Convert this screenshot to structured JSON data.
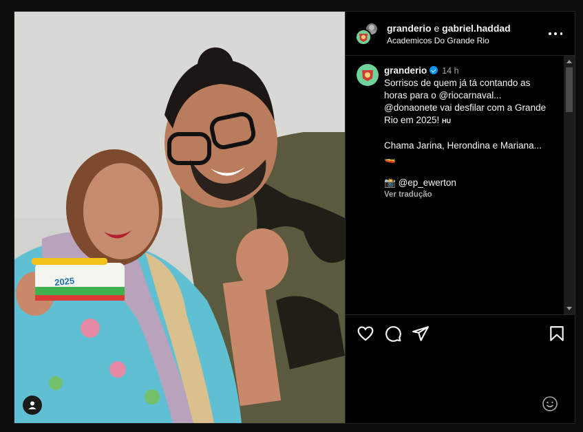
{
  "header": {
    "user_primary": "granderio",
    "conjunction": "e",
    "user_secondary": "gabriel.haddad",
    "location": "Academicos Do Grande Rio"
  },
  "post": {
    "username": "granderio",
    "time": "14 h",
    "lines": [
      "Sorrisos de quem já tá contando as",
      "horas para o @riocarnaval...",
      "@donaonete vai desfilar com a Grande",
      "Rio em 2025!"
    ],
    "hu_tag": "HU",
    "line_after_gap": "Chama Jarina, Herondina e Mariana...",
    "boat_emoji": "🚤",
    "credit_emoji": "📸",
    "credit": "@ep_ewerton",
    "translate": "Ver tradução"
  },
  "photo": {
    "badge_text": "2025"
  },
  "icons": {
    "like": "heart-icon",
    "comment": "comment-icon",
    "share": "send-icon",
    "save": "bookmark-icon",
    "emoji": "emoji-icon",
    "more": "more-dots-icon",
    "tag": "user-tag-icon"
  },
  "colors": {
    "background": "#000000",
    "text": "#f5f5f5",
    "secondary_text": "#a8a8a8",
    "verified": "#0095f6",
    "border": "#262626"
  }
}
